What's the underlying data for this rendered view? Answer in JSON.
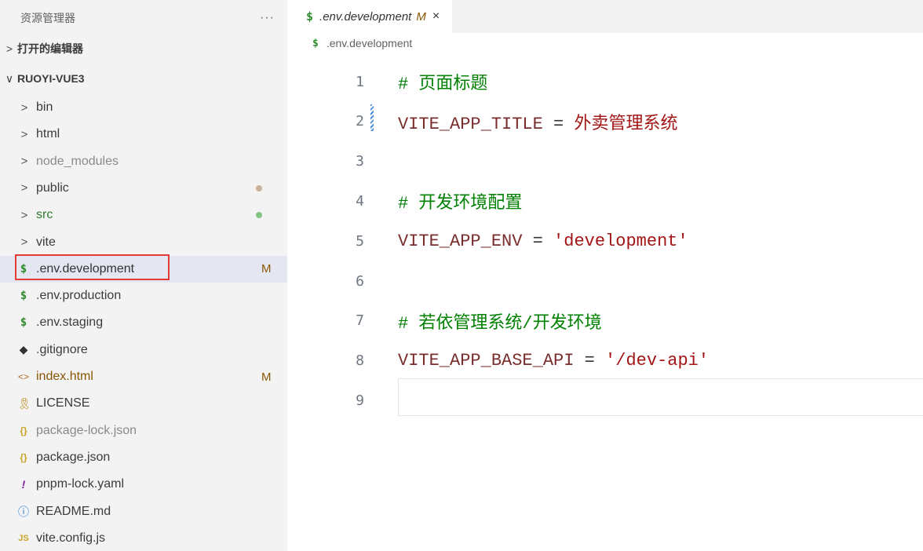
{
  "sidebar": {
    "title": "资源管理器",
    "more": "···",
    "open_editors": {
      "chevron": ">",
      "label": "打开的编辑器"
    },
    "project": {
      "chevron": "∨",
      "label": "RUOYI-VUE3"
    },
    "items": [
      {
        "icon": ">",
        "kind": "folder",
        "label": "bin",
        "color": "#3b3b3b"
      },
      {
        "icon": ">",
        "kind": "folder",
        "label": "html",
        "color": "#3b3b3b"
      },
      {
        "icon": ">",
        "kind": "folder",
        "label": "node_modules",
        "color": "#8a8a8a"
      },
      {
        "icon": ">",
        "kind": "folder",
        "label": "public",
        "color": "#3b3b3b",
        "dot": "#c9b29a"
      },
      {
        "icon": ">",
        "kind": "folder",
        "label": "src",
        "color": "#2e7d32",
        "dot": "#81c784"
      },
      {
        "icon": ">",
        "kind": "folder",
        "label": "vite",
        "color": "#3b3b3b"
      },
      {
        "icon": "$",
        "kind": "env",
        "label": ".env.development",
        "color": "#333333",
        "badge": "M",
        "selected": true
      },
      {
        "icon": "$",
        "kind": "env",
        "label": ".env.production",
        "color": "#3b3b3b"
      },
      {
        "icon": "$",
        "kind": "env",
        "label": ".env.staging",
        "color": "#3b3b3b"
      },
      {
        "icon": "◆",
        "kind": "git",
        "label": ".gitignore",
        "color": "#3b3b3b"
      },
      {
        "icon": "<>",
        "kind": "html",
        "label": "index.html",
        "color": "#895503",
        "badge": "M"
      },
      {
        "icon": "🎗",
        "kind": "license",
        "label": "LICENSE",
        "color": "#3b3b3b"
      },
      {
        "icon": "{}",
        "kind": "json",
        "label": "package-lock.json",
        "color": "#8a8a8a"
      },
      {
        "icon": "{}",
        "kind": "json",
        "label": "package.json",
        "color": "#3b3b3b"
      },
      {
        "icon": "!",
        "kind": "yaml",
        "label": "pnpm-lock.yaml",
        "color": "#3b3b3b"
      },
      {
        "icon": "ⓘ",
        "kind": "info",
        "label": "README.md",
        "color": "#3b3b3b"
      },
      {
        "icon": "JS",
        "kind": "js",
        "label": "vite.config.js",
        "color": "#3b3b3b"
      }
    ]
  },
  "editor": {
    "tab": {
      "icon": "$",
      "filename": ".env.development",
      "modified": "M",
      "close": "×"
    },
    "breadcrumb": {
      "icon": "$",
      "label": ".env.development"
    },
    "lines": [
      {
        "n": "1",
        "text": "# 页面标题",
        "kind": "comment"
      },
      {
        "n": "2",
        "key": "VITE_APP_TITLE",
        "op": " = ",
        "value": "外卖管理系统",
        "kind": "assign"
      },
      {
        "n": "3",
        "text": "",
        "kind": "empty"
      },
      {
        "n": "4",
        "text": "# 开发环境配置",
        "kind": "comment"
      },
      {
        "n": "5",
        "key": "VITE_APP_ENV",
        "op": " = ",
        "value": "'development'",
        "kind": "assign"
      },
      {
        "n": "6",
        "text": "",
        "kind": "empty"
      },
      {
        "n": "7",
        "text": "# 若依管理系统/开发环境",
        "kind": "comment"
      },
      {
        "n": "8",
        "key": "VITE_APP_BASE_API",
        "op": " = ",
        "value": "'/dev-api'",
        "kind": "assign"
      },
      {
        "n": "9",
        "text": "",
        "kind": "empty"
      }
    ]
  },
  "colors": {
    "sidebar_bg": "#f3f3f3",
    "selected_bg": "#e4e6f1",
    "highlight_border": "#e53935",
    "comment": "#008000",
    "string": "#a31515",
    "modified": "#895503"
  }
}
